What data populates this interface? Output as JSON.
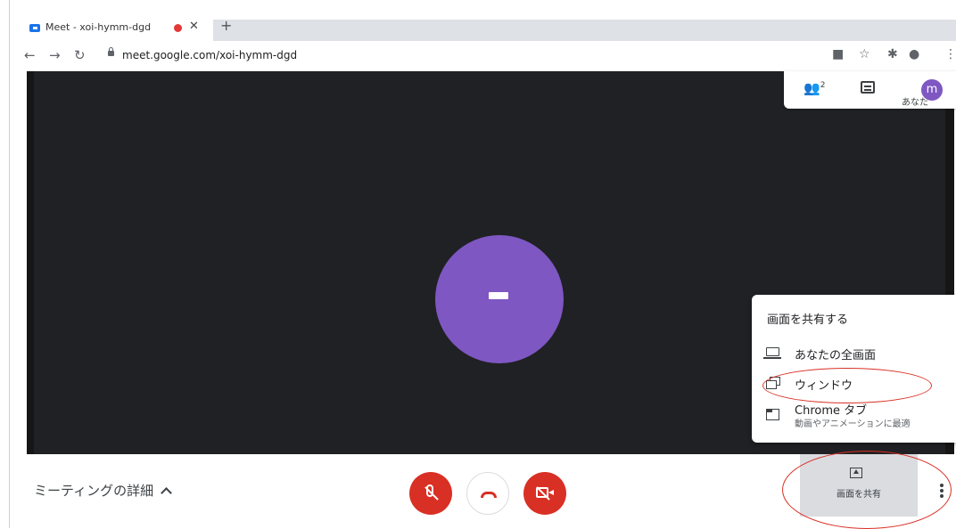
{
  "browser": {
    "tab_title": "Meet - xoi-hymm-dgd",
    "url": "meet.google.com/xoi-hymm-dgd"
  },
  "meet": {
    "participant_count": "2",
    "self_label": "あなた",
    "self_initial": "m",
    "details_label": "ミーティングの詳細"
  },
  "share_menu": {
    "heading": "画面を共有する",
    "items": [
      {
        "label": "あなたの全画面"
      },
      {
        "label": "ウィンドウ"
      },
      {
        "label": "Chrome タブ",
        "sub": "動画やアニメーションに最適"
      }
    ]
  },
  "share_button": {
    "label": "画面を共有"
  },
  "colors": {
    "accent_red": "#d93025",
    "avatar_purple": "#7e57c2",
    "stage_dark": "#202124"
  }
}
